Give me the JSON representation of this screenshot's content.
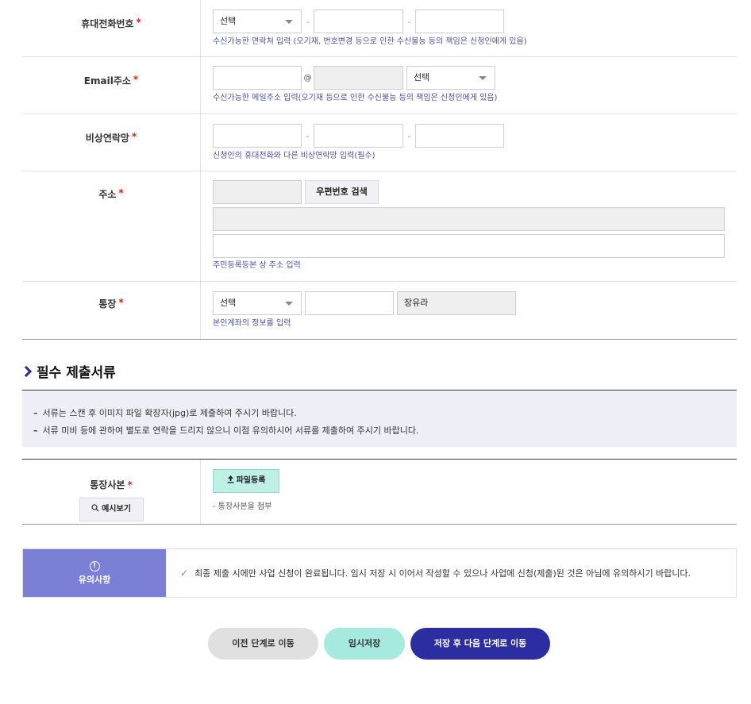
{
  "form": {
    "mobile": {
      "label": "휴대전화번호",
      "required": "*",
      "select": "선택",
      "help": "수신가능한 연락처 입력 (오기재, 번호변경 등으로 인한 수신불능 등의 책임은 신청인에게 있음)"
    },
    "email": {
      "label": "Email주소",
      "required": "*",
      "at": "@",
      "select": "선택",
      "help": "수신가능한 메일주소 입력(오기재 등으로 인한 수신불능 등의 책임은 신청인에게 있음)"
    },
    "emergency": {
      "label": "비상연락망",
      "required": "*",
      "help": "신청인의 휴대전화와 다른 비상연락망 입력(필수)"
    },
    "address": {
      "label": "주소",
      "required": "*",
      "search_button": "우편번호 검색",
      "help": "주민등록등본 상 주소 입력"
    },
    "bank": {
      "label": "통장",
      "required": "*",
      "select": "선택",
      "holder": "장유라",
      "help": "본인계좌의 정보를 입력"
    }
  },
  "documents": {
    "title": "필수 제출서류",
    "notices": [
      "서류는 스캔 후 이미지 파일 확장자(jpg)로 제출하여 주시기 바랍니다.",
      "서류 미비 등에 관하여 별도로 연락을 드리지 않으니 이점 유의하시어 서류를 제출하여 주시기 바랍니다."
    ],
    "notice_bullet": "–",
    "bankbook": {
      "label": "통장사본",
      "required": "*",
      "example_button": "예시보기",
      "upload_button": "파일등록",
      "help": "- 통장사본을 첨부"
    }
  },
  "caution": {
    "title": "유의사항",
    "icon_glyph": "!",
    "text": "최종 제출 시에만 사업 신청이 완료됩니다. 임시 저장 시 이어서 작성할 수 있으나 사업에 신청(제출)된 것은 아님에 유의하시기 바랍니다."
  },
  "actions": {
    "prev": "이전 단계로 이동",
    "temp_save": "임시저장",
    "next": "저장 후 다음 단계로 이동"
  },
  "colors": {
    "accent": "#2b2da0",
    "caution_head": "#7b80d6",
    "upload_btn": "#bff0e6",
    "temp_btn": "#a6e9df",
    "required": "#e02020"
  }
}
